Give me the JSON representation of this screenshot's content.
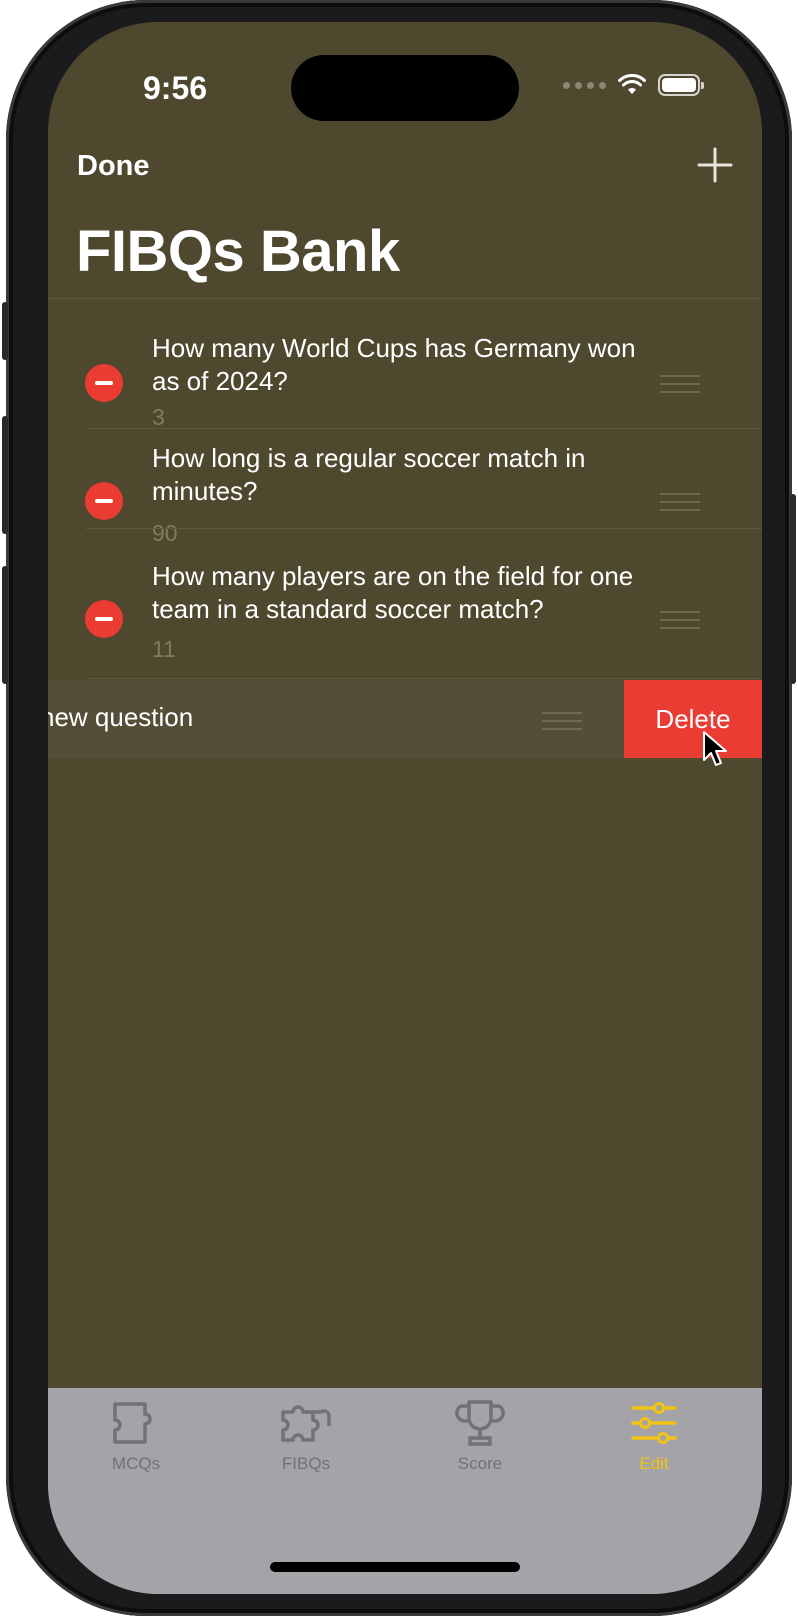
{
  "status_bar": {
    "time": "9:56",
    "icons": [
      "cellular-dots-icon",
      "wifi-icon",
      "battery-icon"
    ]
  },
  "nav": {
    "done_label": "Done",
    "add_icon": "plus-icon",
    "title": "FIBQs Bank"
  },
  "questions": [
    {
      "text": "How  many World Cups has Germany won as of 2024?",
      "answer": "3"
    },
    {
      "text": "How long is a regular soccer match in minutes?",
      "answer": "90"
    },
    {
      "text": "How many players are on the field for one team in a standard soccer match?",
      "answer": "11"
    }
  ],
  "swiped_row": {
    "text": "new question",
    "delete_label": "Delete"
  },
  "tab_bar": {
    "tabs": [
      {
        "label": "MCQs",
        "icon": "puzzle-piece-icon",
        "active": false
      },
      {
        "label": "FIBQs",
        "icon": "puzzle-icon",
        "active": false
      },
      {
        "label": "Score",
        "icon": "trophy-icon",
        "active": false
      },
      {
        "label": "Edit",
        "icon": "sliders-icon",
        "active": true
      }
    ]
  },
  "colors": {
    "background": "#4e482f",
    "destructive": "#ea3c33",
    "active_tab": "#f2c315",
    "tab_bar": "#a4a4a8"
  }
}
